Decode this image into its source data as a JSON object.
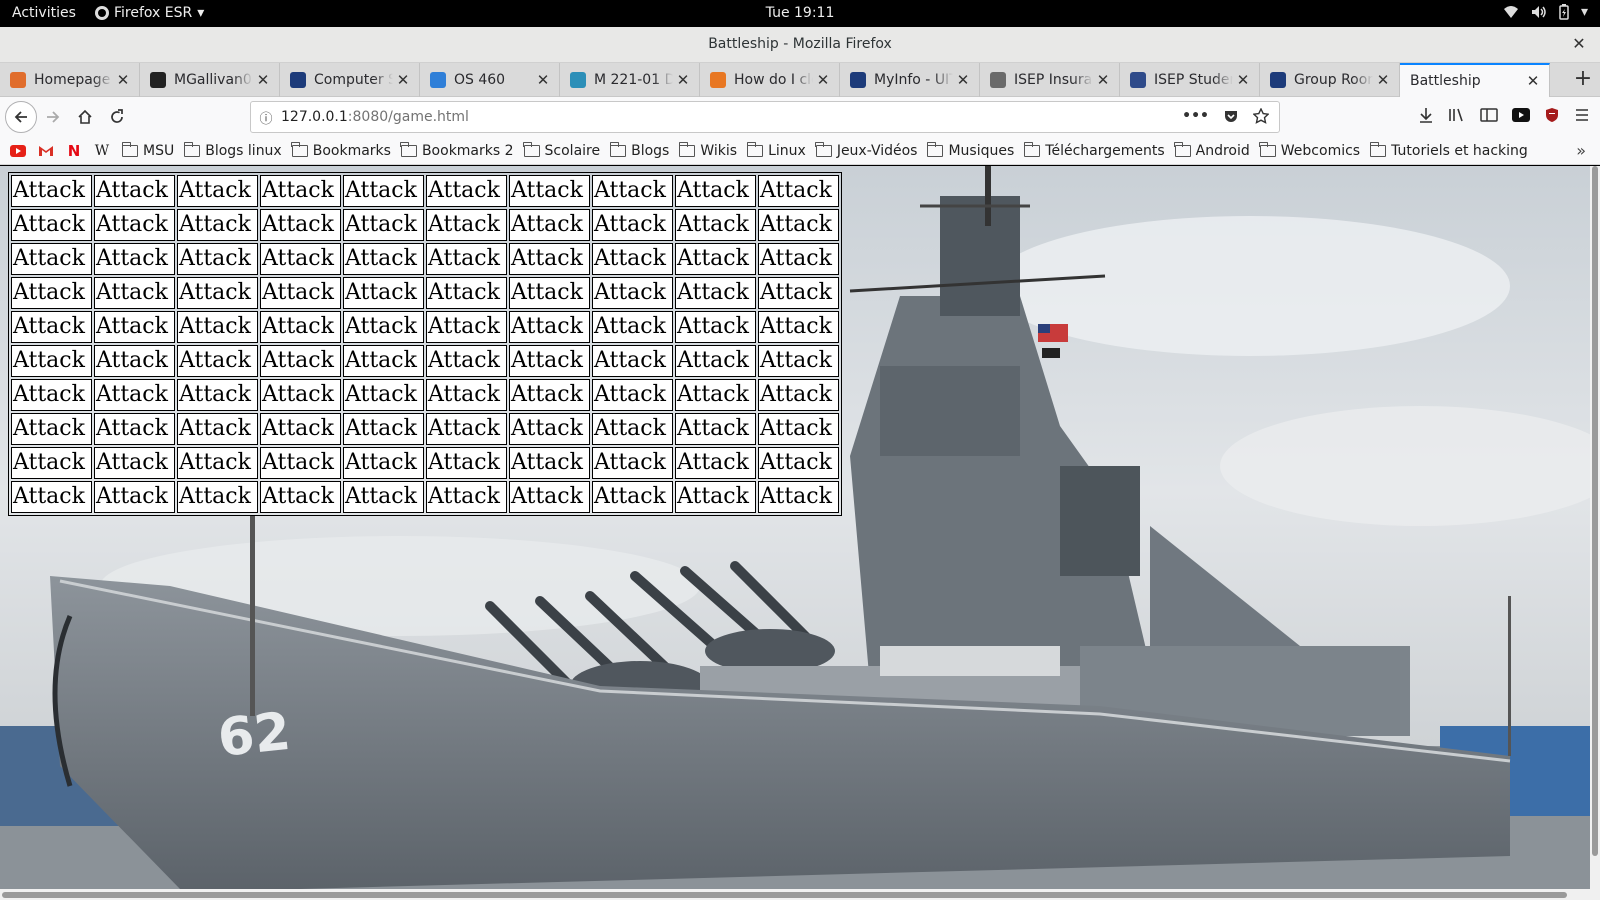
{
  "topbar": {
    "activities": "Activities",
    "app_name": "Firefox ESR",
    "clock": "Tue 19:11"
  },
  "window": {
    "title": "Battleship - Mozilla Firefox"
  },
  "tabs": [
    {
      "label": "Homepage -",
      "icon": "homepage-favicon",
      "color": "#e06d2c"
    },
    {
      "label": "MGallivan0",
      "icon": "github-favicon",
      "color": "#222222"
    },
    {
      "label": "Computer S",
      "icon": "m-favicon",
      "color": "#1d3b7a"
    },
    {
      "label": "OS 460",
      "icon": "t-favicon",
      "color": "#2f7fd8"
    },
    {
      "label": "M 221-01 Da",
      "icon": "chart-favicon",
      "color": "#2c8fb8"
    },
    {
      "label": "How do I clo",
      "icon": "stack-favicon",
      "color": "#e87722"
    },
    {
      "label": "MyInfo - UIT",
      "icon": "m-favicon",
      "color": "#1d3b7a"
    },
    {
      "label": "ISEP Insuran",
      "icon": "circle-favicon",
      "color": "#6a6a6a"
    },
    {
      "label": "ISEP Studen",
      "icon": "isep-favicon",
      "color": "#2f4b8a"
    },
    {
      "label": "Group Room",
      "icon": "m-favicon",
      "color": "#1d3b7a"
    },
    {
      "label": "Battleship",
      "icon": "none",
      "color": "#ffffff",
      "active": true
    }
  ],
  "navbar": {
    "url_host": "127.0.0.1",
    "url_rest": ":8080/game.html"
  },
  "bookmarks": {
    "folders": [
      "MSU",
      "Blogs linux",
      "Bookmarks",
      "Bookmarks 2",
      "Scolaire",
      "Blogs",
      "Wikis",
      "Linux",
      "Jeux-Vidéos",
      "Musiques",
      "Téléchargements",
      "Android",
      "Webcomics",
      "Tutoriels et hacking"
    ]
  },
  "board": {
    "rows": 10,
    "cols": 10,
    "cell_label": "Attack"
  },
  "ship": {
    "hull_number": "62"
  }
}
